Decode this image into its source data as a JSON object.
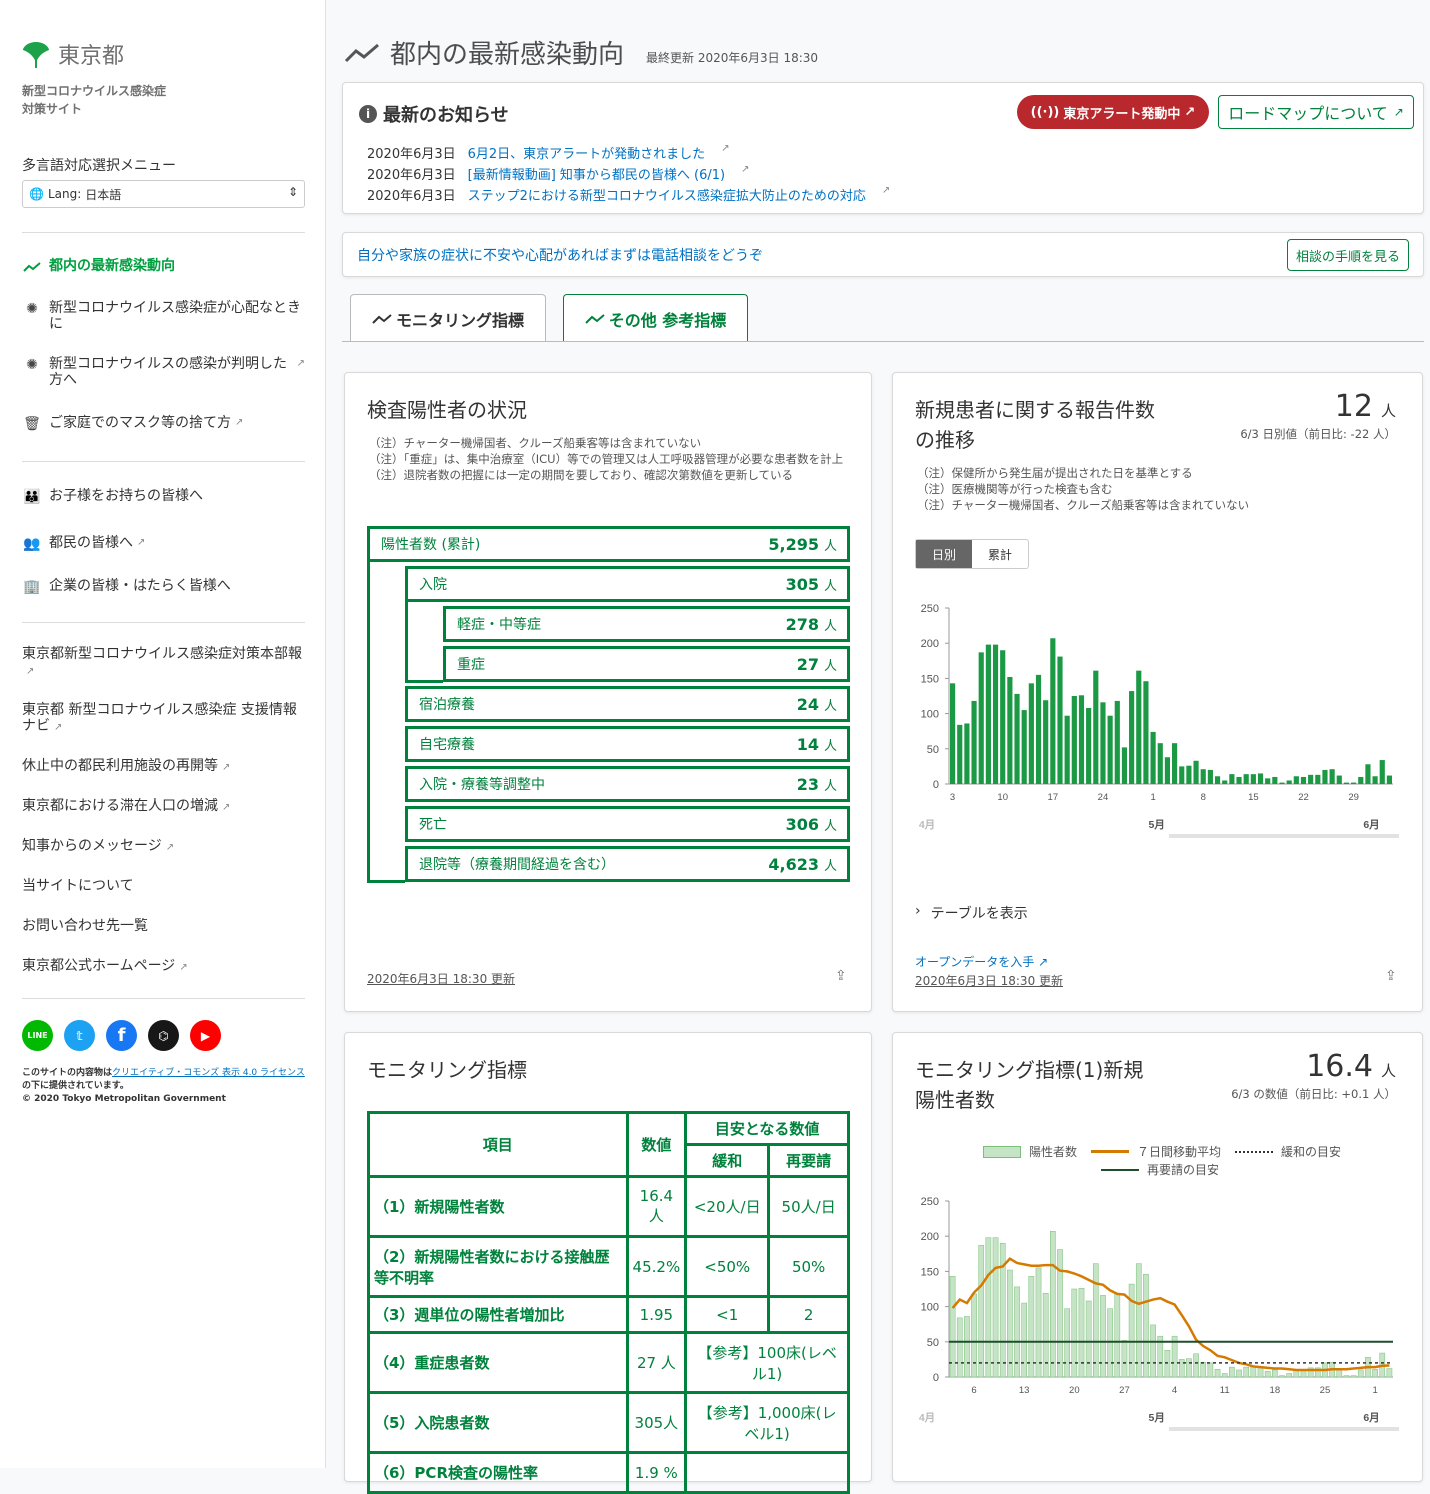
{
  "sidebar": {
    "logo_text": "東京都",
    "site_name_1": "新型コロナウイルス感染症",
    "site_name_2": "対策サイト",
    "lang_label": "多言語対応選択メニュー",
    "lang_prefix": "Lang:",
    "lang_value": "日本語",
    "nav": [
      {
        "label": "都内の最新感染動向"
      },
      {
        "label": "新型コロナウイルス感染症が心配なときに"
      },
      {
        "label": "新型コロナウイルスの感染が判明した方へ"
      },
      {
        "label": "ご家庭でのマスク等の捨て方"
      },
      {
        "label": "お子様をお持ちの皆様へ"
      },
      {
        "label": "都民の皆様へ"
      },
      {
        "label": "企業の皆様・はたらく皆様へ"
      }
    ],
    "links": [
      "東京都新型コロナウイルス感染症対策本部報",
      "東京都 新型コロナウイルス感染症 支援情報ナビ",
      "休止中の都民利用施設の再開等",
      "東京都における滞在人口の増減",
      "知事からのメッセージ",
      "当サイトについて",
      "お問い合わせ先一覧",
      "東京都公式ホームページ"
    ],
    "social": [
      "LINE",
      "Twitter",
      "Facebook",
      "GitHub",
      "YouTube"
    ],
    "license_1": "このサイトの内容物は",
    "license_link": "クリエイティブ・コモンズ 表示 4.0 ライセンス",
    "license_2": "の下に提供されています。",
    "copyright": "© 2020 Tokyo Metropolitan Government"
  },
  "header": {
    "title": "都内の最新感染動向",
    "updated": "最終更新 2020年6月3日 18:30"
  },
  "news": {
    "heading": "最新のお知らせ",
    "alert_button": "東京アラート発動中",
    "roadmap_button": "ロードマップについて",
    "items": [
      {
        "date": "2020年6月3日",
        "text": "6月2日、東京アラートが発動されました"
      },
      {
        "date": "2020年6月3日",
        "text": "[最新情報動画] 知事から都民の皆様へ (6/1)"
      },
      {
        "date": "2020年6月3日",
        "text": "ステップ2における新型コロナウイルス感染症拡大防止のための対応"
      }
    ]
  },
  "consult": {
    "text": "自分や家族の症状に不安や心配があればまずは電話相談をどうぞ",
    "button": "相談の手順を見る"
  },
  "tabs": [
    {
      "label": "モニタリング指標"
    },
    {
      "label": "その他 参考指標"
    }
  ],
  "positive_card": {
    "title": "検査陽性者の状況",
    "notes": [
      "（注）チャーター機帰国者、クルーズ船乗客等は含まれていない",
      "（注）「重症」は、集中治療室（ICU）等での管理又は人工呼吸器管理が必要な患者数を計上",
      "（注）退院者数の把握には一定の期間を要しており、確認次第数値を更新している"
    ],
    "unit": "人",
    "rows": [
      {
        "label": "陽性者数 (累計)",
        "value": "5,295"
      },
      {
        "label": "入院",
        "value": "305"
      },
      {
        "label": "軽症・中等症",
        "value": "278"
      },
      {
        "label": "重症",
        "value": "27"
      },
      {
        "label": "宿泊療養",
        "value": "24"
      },
      {
        "label": "自宅療養",
        "value": "14"
      },
      {
        "label": "入院・療養等調整中",
        "value": "23"
      },
      {
        "label": "死亡",
        "value": "306"
      },
      {
        "label": "退院等（療養期間経過を含む）",
        "value": "4,623"
      }
    ],
    "updated": "2020年6月3日 18:30 更新"
  },
  "reports_card": {
    "title_1": "新規患者に関する報告件数",
    "title_2": "の推移",
    "big_value": "12",
    "big_unit": "人",
    "sub": "6/3 日別値（前日比: -22 人）",
    "notes": [
      "（注）保健所から発生届が提出された日を基準とする",
      "（注）医療機関等が行った検査も含む",
      "（注）チャーター機帰国者、クルーズ船乗客等は含まれていない"
    ],
    "seg_daily": "日別",
    "seg_total": "累計",
    "show_table": "テーブルを表示",
    "open_data": "オープンデータを入手",
    "updated": "2020年6月3日 18:30 更新"
  },
  "monitor_card": {
    "title": "モニタリング指標",
    "head_item": "項目",
    "head_value": "数値",
    "head_target": "目安となる数値",
    "head_ease": "緩和",
    "head_re": "再要請",
    "rows": [
      {
        "item": "（1）新規陽性者数",
        "value": "16.4人",
        "ease": "<20人/日",
        "re": "50人/日"
      },
      {
        "item": "（2）新規陽性者数における接触歴等不明率",
        "value": "45.2%",
        "ease": "<50%",
        "re": "50%"
      },
      {
        "item": "（3）週単位の陽性者増加比",
        "value": "1.95",
        "ease": "<1",
        "re": "2"
      },
      {
        "item": "（4）重症患者数",
        "value": "27 人",
        "merged": "【参考】100床(レベル1)"
      },
      {
        "item": "（5）入院患者数",
        "value": "305人",
        "merged": "【参考】1,000床(レベル1)"
      },
      {
        "item": "（6）PCR検査の陽性率",
        "value": "1.9 %",
        "merged": ""
      }
    ]
  },
  "monitor1_card": {
    "title_1": "モニタリング指標(1)新規",
    "title_2": "陽性者数",
    "big_value": "16.4",
    "big_unit": "人",
    "sub": "6/3 の数値（前日比: +0.1 人）",
    "legend": [
      "陽性者数",
      "７日間移動平均",
      "緩和の目安",
      "再要請の目安"
    ]
  },
  "colors": {
    "green": "#00823c",
    "bar": "#1b9944",
    "light_bar": "#c5e3c5",
    "avg": "#d57a00",
    "alert": "#b8282c"
  },
  "chart_data": [
    {
      "type": "bar",
      "title": "新規患者に関する報告件数の推移",
      "ylim": [
        0,
        250
      ],
      "yticks": [
        0,
        50,
        100,
        150,
        200,
        250
      ],
      "x_tick_labels": [
        "3",
        "10",
        "17",
        "24",
        "1",
        "8",
        "15",
        "22",
        "29"
      ],
      "month_labels": [
        "4月",
        "5月",
        "6月"
      ],
      "values": [
        143,
        84,
        86,
        118,
        187,
        198,
        198,
        190,
        152,
        128,
        105,
        143,
        155,
        119,
        207,
        181,
        97,
        125,
        126,
        108,
        161,
        116,
        97,
        118,
        52,
        132,
        161,
        146,
        74,
        58,
        38,
        58,
        25,
        26,
        33,
        21,
        20,
        11,
        5,
        14,
        10,
        14,
        14,
        15,
        8,
        10,
        2,
        5,
        11,
        10,
        13,
        13,
        20,
        21,
        12,
        2,
        2,
        10,
        28,
        11,
        34,
        12
      ]
    },
    {
      "type": "bar",
      "title": "モニタリング指標(1)新規陽性者数",
      "ylim": [
        0,
        250
      ],
      "yticks": [
        0,
        50,
        100,
        150,
        200,
        250
      ],
      "x_tick_labels": [
        "6",
        "13",
        "20",
        "27",
        "4",
        "11",
        "18",
        "25",
        "1"
      ],
      "month_labels": [
        "4月",
        "5月",
        "6月"
      ],
      "series": [
        {
          "name": "陽性者数",
          "values": [
            143,
            84,
            86,
            118,
            187,
            198,
            198,
            190,
            152,
            128,
            105,
            143,
            155,
            119,
            207,
            181,
            97,
            125,
            126,
            108,
            161,
            116,
            97,
            118,
            52,
            132,
            161,
            146,
            74,
            58,
            38,
            58,
            25,
            26,
            33,
            21,
            20,
            11,
            5,
            14,
            10,
            14,
            14,
            15,
            8,
            10,
            2,
            5,
            11,
            10,
            13,
            13,
            20,
            21,
            12,
            2,
            2,
            10,
            28,
            11,
            34,
            12
          ]
        },
        {
          "name": "７日間移動平均",
          "values": [
            98,
            110,
            105,
            120,
            130,
            145,
            155,
            157,
            168,
            162,
            160,
            158,
            158,
            159,
            159,
            151,
            150,
            147,
            143,
            138,
            133,
            131,
            123,
            118,
            117,
            108,
            104,
            107,
            110,
            112,
            107,
            103,
            88,
            72,
            53,
            44,
            38,
            30,
            28,
            24,
            20,
            18,
            15,
            14,
            13,
            12,
            12,
            11,
            10,
            10,
            10,
            10,
            10,
            11,
            11,
            11,
            12,
            13,
            14,
            14,
            16,
            16.4
          ]
        },
        {
          "name": "緩和の目安",
          "values": [
            20
          ]
        },
        {
          "name": "再要請の目安",
          "values": [
            50
          ]
        }
      ]
    }
  ]
}
